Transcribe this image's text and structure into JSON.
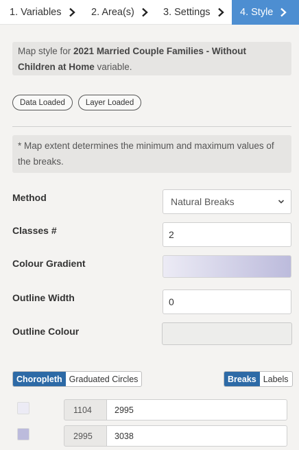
{
  "wizard": {
    "steps": [
      {
        "label": "1. Variables"
      },
      {
        "label": "2. Area(s)"
      },
      {
        "label": "3. Settings"
      },
      {
        "label": "4. Style",
        "active": true
      }
    ]
  },
  "info": {
    "prefix": "Map style for ",
    "variable_name": "2021 Married Couple Families - Without Children at Home",
    "suffix": " variable."
  },
  "badges": [
    "Data Loaded",
    "Layer Loaded"
  ],
  "extent_note": "* Map extent determines the minimum and maximum values of the breaks.",
  "form": {
    "method": {
      "label": "Method",
      "value": "Natural Breaks"
    },
    "classes": {
      "label": "Classes #",
      "value": "2"
    },
    "gradient": {
      "label": "Colour Gradient",
      "from": "#ecebf5",
      "to": "#bcbbdc"
    },
    "outline_width": {
      "label": "Outline Width",
      "value": "0"
    },
    "outline_colour": {
      "label": "Outline Colour",
      "value": "#ededeb"
    }
  },
  "style_toggle": {
    "options": [
      "Choropleth",
      "Graduated Circles"
    ],
    "selected": "Choropleth"
  },
  "view_toggle": {
    "options": [
      "Breaks",
      "Labels"
    ],
    "selected": "Breaks"
  },
  "breaks": [
    {
      "color": "#ecebf5",
      "lower": "1104",
      "upper": "2995"
    },
    {
      "color": "#bcbbdc",
      "lower": "2995",
      "upper": "3038"
    }
  ],
  "colors": {
    "accent": "#4d8ed1",
    "toggle_active": "#2d6aa6"
  }
}
